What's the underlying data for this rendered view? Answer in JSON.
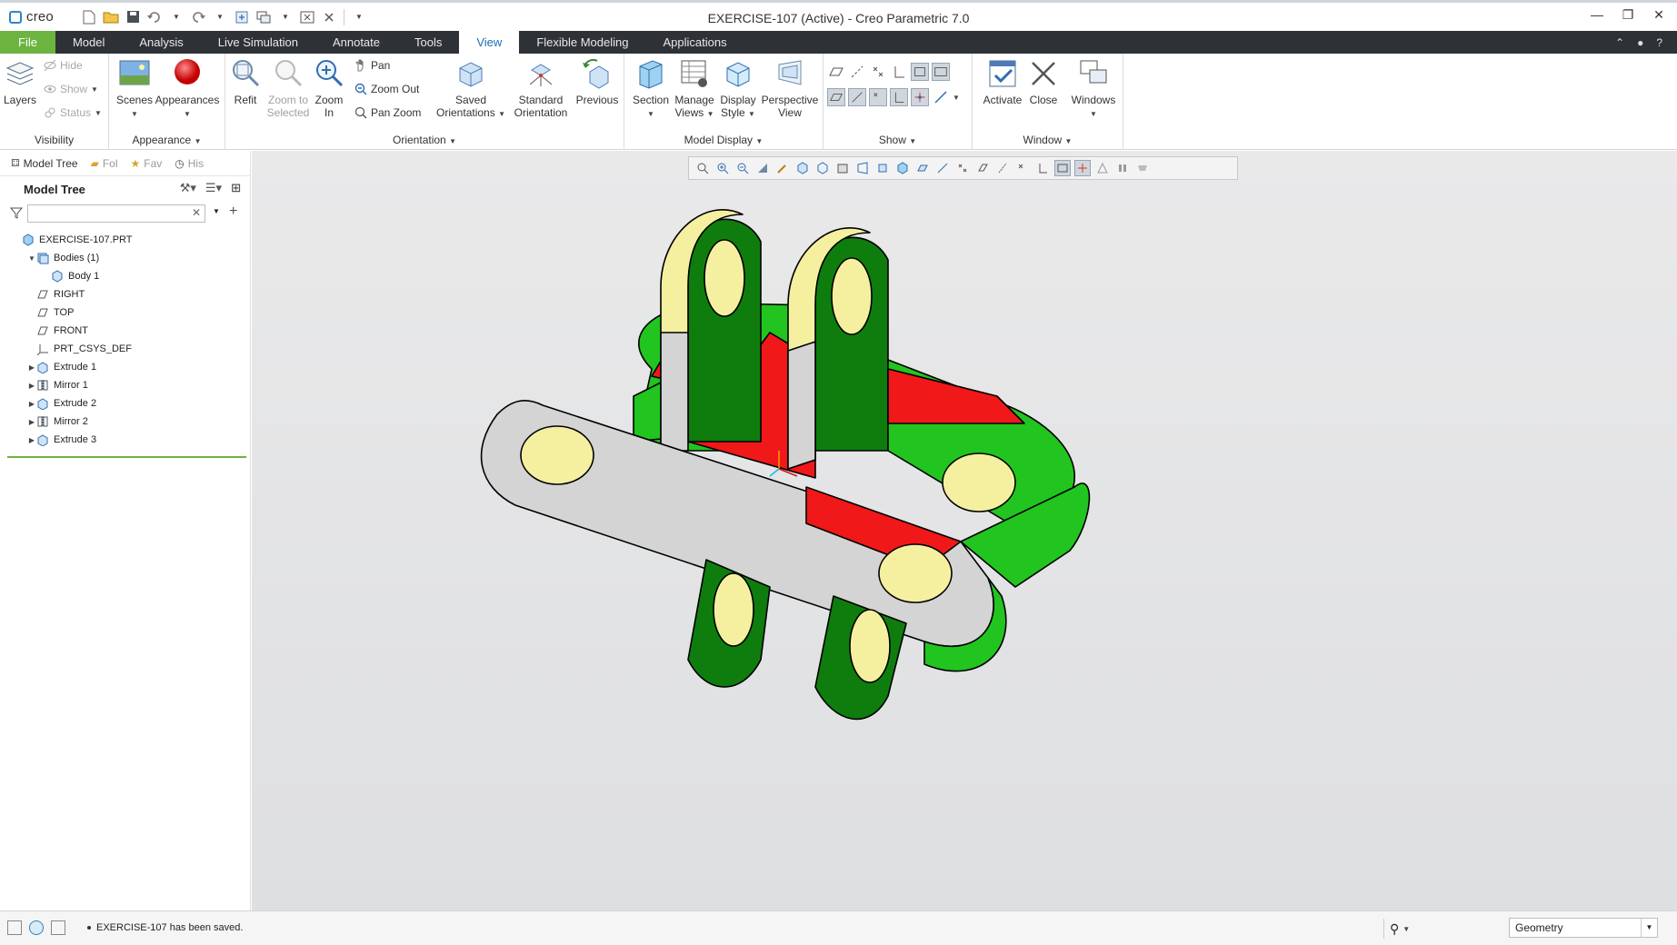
{
  "window": {
    "brand": "creo",
    "title": "EXERCISE-107 (Active) - Creo Parametric 7.0",
    "controls": [
      "minimize",
      "maximize",
      "close"
    ]
  },
  "tabs": [
    {
      "label": "File",
      "state": "file"
    },
    {
      "label": "Model",
      "state": "normal"
    },
    {
      "label": "Analysis",
      "state": "normal"
    },
    {
      "label": "Live Simulation",
      "state": "normal"
    },
    {
      "label": "Annotate",
      "state": "normal"
    },
    {
      "label": "Tools",
      "state": "normal"
    },
    {
      "label": "View",
      "state": "active"
    },
    {
      "label": "Flexible Modeling",
      "state": "normal"
    },
    {
      "label": "Applications",
      "state": "normal"
    }
  ],
  "ribbon": {
    "visibility": {
      "group_label": "Visibility",
      "layers": "Layers",
      "hide": "Hide",
      "show": "Show",
      "status": "Status"
    },
    "appearance": {
      "group_label": "Appearance",
      "scenes": "Scenes",
      "appearances": "Appearances"
    },
    "orientation": {
      "group_label": "Orientation",
      "refit": "Refit",
      "zoom_selected_1": "Zoom to",
      "zoom_selected_2": "Selected",
      "zoom_in_1": "Zoom",
      "zoom_in_2": "In",
      "pan": "Pan",
      "zoom_out": "Zoom Out",
      "pan_zoom": "Pan Zoom",
      "saved_1": "Saved",
      "saved_2": "Orientations",
      "standard_1": "Standard",
      "standard_2": "Orientation",
      "previous": "Previous"
    },
    "model_display": {
      "group_label": "Model Display",
      "section": "Section",
      "manage_1": "Manage",
      "manage_2": "Views",
      "display_1": "Display",
      "display_2": "Style",
      "perspective_1": "Perspective",
      "perspective_2": "View"
    },
    "show": {
      "group_label": "Show"
    },
    "window_group": {
      "group_label": "Window",
      "activate": "Activate",
      "close": "Close",
      "windows": "Windows"
    }
  },
  "navigator": {
    "tabs": [
      {
        "label": "Model Tree",
        "dim": false
      },
      {
        "label": "Fol",
        "dim": true
      },
      {
        "label": "Fav",
        "dim": true
      },
      {
        "label": "His",
        "dim": true
      }
    ],
    "tree_title": "Model Tree",
    "search_placeholder": ""
  },
  "tree": [
    {
      "label": "EXERCISE-107.PRT",
      "indent": 0,
      "expander": "",
      "icon": "part-icon"
    },
    {
      "label": "Bodies (1)",
      "indent": 1,
      "expander": "▼",
      "icon": "bodies-icon"
    },
    {
      "label": "Body 1",
      "indent": 2,
      "expander": "",
      "icon": "body-icon"
    },
    {
      "label": "RIGHT",
      "indent": 1,
      "expander": "",
      "icon": "datum-plane-icon"
    },
    {
      "label": "TOP",
      "indent": 1,
      "expander": "",
      "icon": "datum-plane-icon"
    },
    {
      "label": "FRONT",
      "indent": 1,
      "expander": "",
      "icon": "datum-plane-icon"
    },
    {
      "label": "PRT_CSYS_DEF",
      "indent": 1,
      "expander": "",
      "icon": "csys-icon"
    },
    {
      "label": "Extrude 1",
      "indent": 1,
      "expander": "▶",
      "icon": "extrude-icon"
    },
    {
      "label": "Mirror 1",
      "indent": 1,
      "expander": "▶",
      "icon": "mirror-icon"
    },
    {
      "label": "Extrude 2",
      "indent": 1,
      "expander": "▶",
      "icon": "extrude-icon"
    },
    {
      "label": "Mirror 2",
      "indent": 1,
      "expander": "▶",
      "icon": "mirror-icon"
    },
    {
      "label": "Extrude 3",
      "indent": 1,
      "expander": "▶",
      "icon": "extrude-icon"
    }
  ],
  "status": {
    "message": "EXERCISE-107 has been saved.",
    "filter_value": "Geometry"
  },
  "colors": {
    "file_tab": "#6cb33f",
    "tab_bar": "#2e3237",
    "active_tab_text": "#1c6fb5",
    "model_green": "#22c41f",
    "model_red": "#f01818",
    "model_gray": "#d4d4d4",
    "model_yellow": "#f4f0a0"
  }
}
